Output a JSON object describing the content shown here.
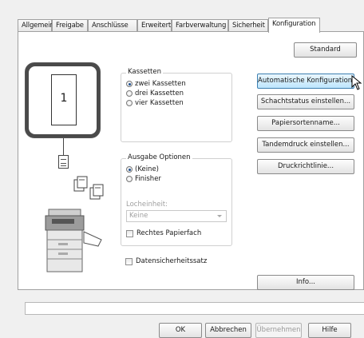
{
  "tabs": [
    {
      "label": "Allgemein",
      "active": false
    },
    {
      "label": "Freigabe",
      "active": false
    },
    {
      "label": "Anschlüsse",
      "active": false
    },
    {
      "label": "Erweitert",
      "active": false
    },
    {
      "label": "Farbverwaltung",
      "active": false
    },
    {
      "label": "Sicherheit",
      "active": false
    },
    {
      "label": "Konfiguration",
      "active": true
    }
  ],
  "standard_button": "Standard",
  "preview": {
    "tray_number": "1"
  },
  "cassettes": {
    "legend": "Kassetten",
    "options": [
      "zwei Kassetten",
      "drei Kassetten",
      "vier Kassetten"
    ],
    "selected": 0
  },
  "output": {
    "legend": "Ausgabe Optionen",
    "options": [
      "(Keine)",
      "Finisher"
    ],
    "selected": 0,
    "punch_label": "Locheinheit:",
    "punch_value": "Keine",
    "right_tray_label": "Rechtes Papierfach"
  },
  "data_security_label": "Datensicherheitssatz",
  "side_buttons": {
    "auto_config": "Automatische Konfiguration...",
    "tray_status": "Schachtstatus einstellen...",
    "paper_type": "Papiersortenname...",
    "tandem": "Tandemdruck einstellen...",
    "policy": "Druckrichtlinie...",
    "info": "Info..."
  },
  "footer": {
    "ok": "OK",
    "cancel": "Abbrechen",
    "apply": "Übernehmen",
    "help": "Hilfe"
  }
}
